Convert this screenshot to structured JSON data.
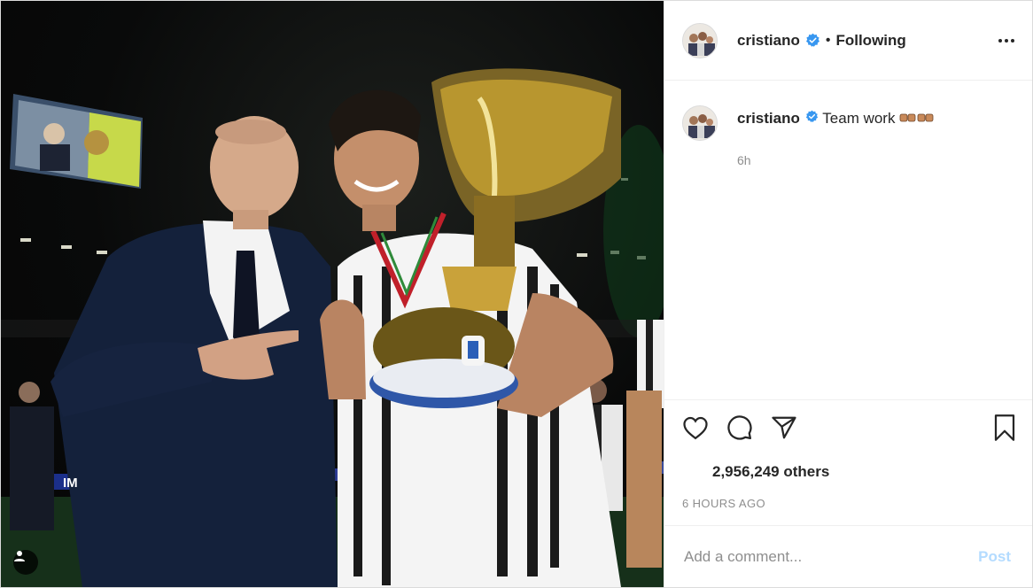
{
  "post": {
    "author": {
      "username": "cristiano",
      "verified": true,
      "follow_state": "Following",
      "separator": "•"
    },
    "caption": {
      "username": "cristiano",
      "text": "Team work",
      "emoji": "fist-bump",
      "time": "6h"
    },
    "likes_text": "2,956,249 others",
    "timestamp": "6 HOURS AGO",
    "comment_box": {
      "placeholder": "Add a comment...",
      "post_label": "Post"
    },
    "photo": {
      "scoreboard_text": "IM"
    }
  },
  "icons": {
    "verified": "verified-badge-icon",
    "more": "more-options-icon",
    "like": "heart-icon",
    "comment": "comment-icon",
    "share": "share-icon",
    "save": "bookmark-icon",
    "tagged": "user-tag-icon"
  },
  "colors": {
    "verified_blue": "#3897f0",
    "post_button_disabled": "#b3dbff",
    "secondary_text": "#8e8e8e",
    "primary_text": "#262626"
  }
}
